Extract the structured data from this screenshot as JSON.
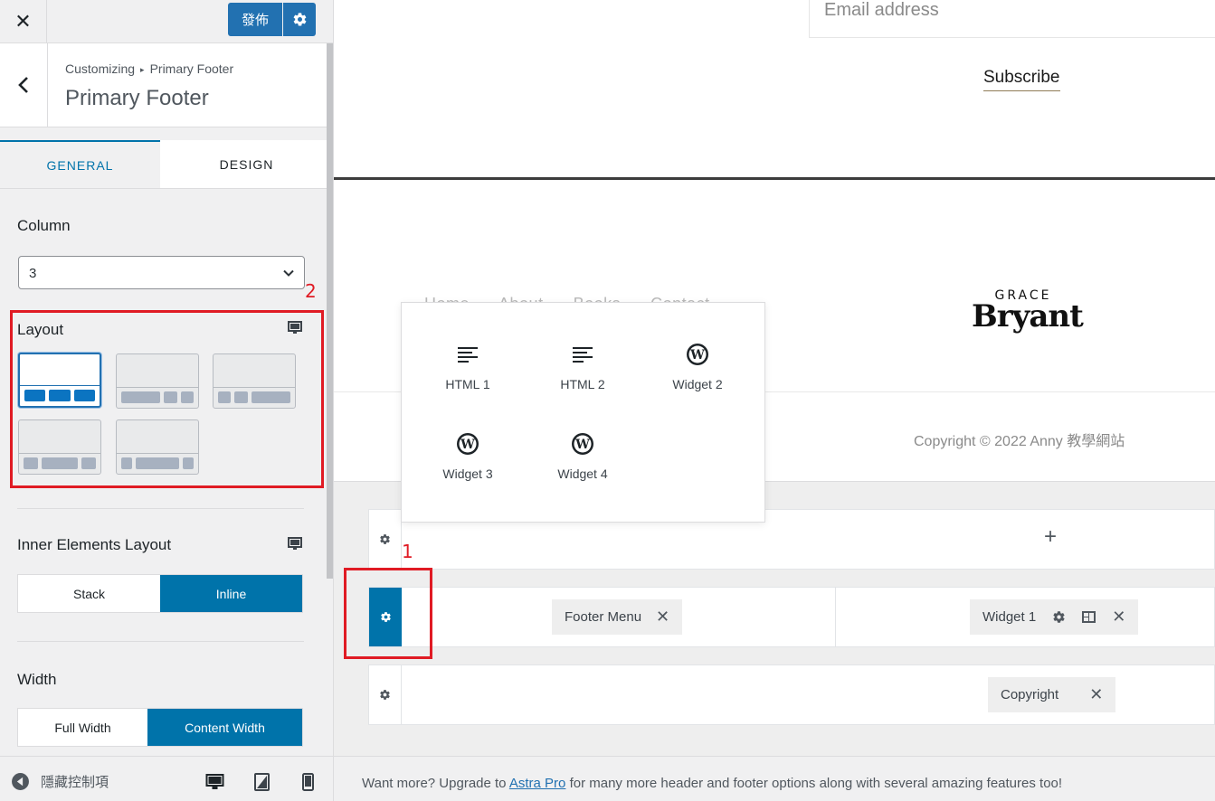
{
  "topbar": {
    "close_label": "✕",
    "publish_label": "發佈"
  },
  "section": {
    "breadcrumb_root": "Customizing",
    "breadcrumb_current": "Primary Footer",
    "title": "Primary Footer"
  },
  "tabs": {
    "general": "GENERAL",
    "design": "DESIGN"
  },
  "column": {
    "label": "Column",
    "value": "3"
  },
  "annotations": {
    "two": "2",
    "one": "1"
  },
  "layout": {
    "label": "Layout",
    "selected_index": 0,
    "options": [
      "equal-thirds",
      "wide-left",
      "wide-right",
      "wide-center",
      "wide-center-alt"
    ]
  },
  "inner_layout": {
    "label": "Inner Elements Layout",
    "options": [
      "Stack",
      "Inline"
    ],
    "selected": "Inline"
  },
  "width": {
    "label": "Width",
    "options": [
      "Full Width",
      "Content Width"
    ],
    "selected": "Content Width"
  },
  "footer_bar": {
    "hide_controls": "隱藏控制項"
  },
  "preview": {
    "email_placeholder": "Email address",
    "subscribe": "Subscribe",
    "nav": [
      "Home",
      "About",
      "Books",
      "Contact"
    ],
    "brand_small": "GRACE",
    "brand_big": "Bryant",
    "copyright": "Copyright © 2022 Anny 教學網站"
  },
  "popover": {
    "items": [
      {
        "label": "HTML 1",
        "icon": "html-icon"
      },
      {
        "label": "HTML 2",
        "icon": "html-icon"
      },
      {
        "label": "Widget 2",
        "icon": "wordpress-icon"
      },
      {
        "label": "Widget 3",
        "icon": "wordpress-icon"
      },
      {
        "label": "Widget 4",
        "icon": "wordpress-icon"
      }
    ]
  },
  "builder": {
    "add_label": "+",
    "primary_row": {
      "left_chip": "Footer Menu",
      "right_chip": "Widget 1"
    },
    "below_row": {
      "chip": "Copyright"
    }
  },
  "upgrade": {
    "prefix": "Want more? Upgrade to ",
    "link": "Astra Pro",
    "suffix": " for many more header and footer options along with several amazing features too!"
  },
  "colors": {
    "accent": "#0073aa",
    "publish": "#2271b1",
    "annotation": "#e01b24"
  }
}
